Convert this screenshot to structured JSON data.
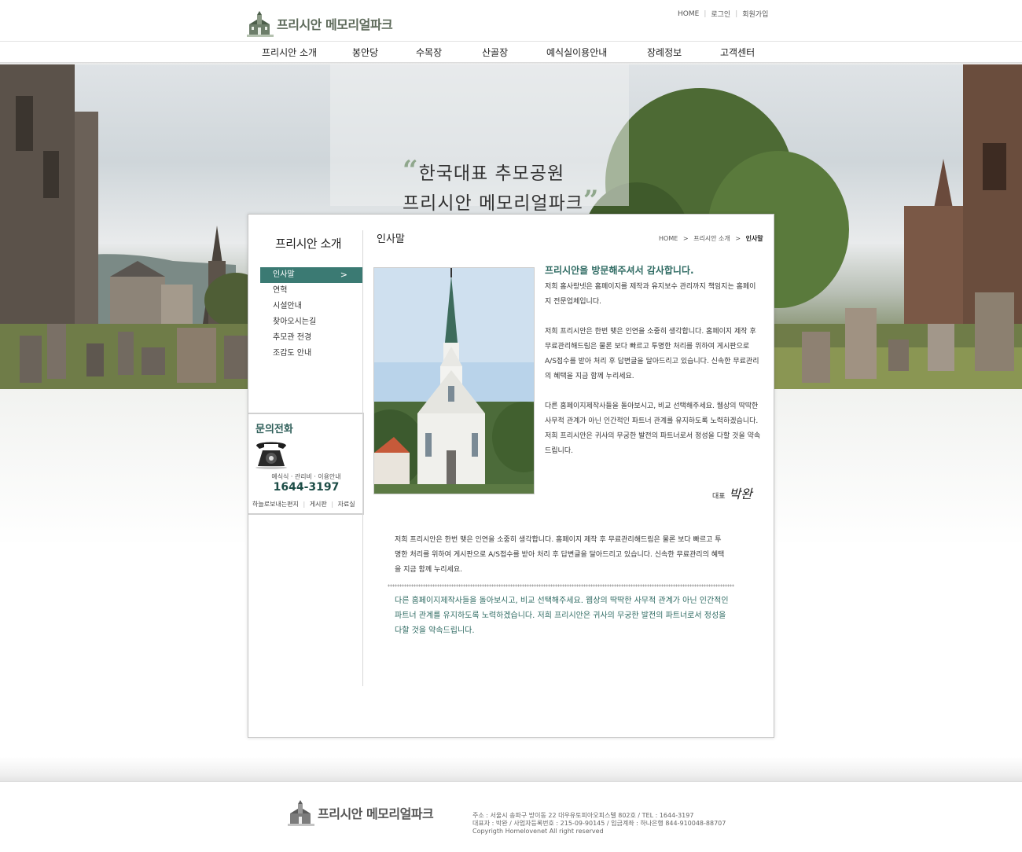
{
  "header": {
    "logo_text": "프리시안 메모리얼파크",
    "top_links": [
      "HOME",
      "로그인",
      "회원가입"
    ],
    "nav": [
      "프리시안 소개",
      "봉안당",
      "수목장",
      "산골장",
      "예식실이용안내",
      "장례정보",
      "고객센터"
    ]
  },
  "hero": {
    "quote_line1": "한국대표 추모공원",
    "quote_line2": "프리시안 메모리얼파크"
  },
  "sidebar": {
    "title": "프리시안 소개",
    "items": [
      {
        "label": "인사말",
        "active": true
      },
      {
        "label": "연혁"
      },
      {
        "label": "시설안내"
      },
      {
        "label": "찾아오시는길"
      },
      {
        "label": "추모관 전경"
      },
      {
        "label": "조감도 안내"
      }
    ],
    "active_arrow": ">",
    "contact": {
      "title": "문의전화",
      "sub": "예식식ㆍ관리비ㆍ이용안내",
      "number": "1644-3197",
      "links": [
        "하늘로보내는편지",
        "게시판",
        "자료실"
      ]
    }
  },
  "content": {
    "page_title": "인사말",
    "breadcrumb": [
      "HOME",
      "프리시안 소개",
      "인사말"
    ],
    "greeting_title": "프리시안을 방문해주셔서 감사합니다.",
    "paragraphs": [
      "저희 홈사랑넷은 홈페이지를 제작과 유지보수 관리까지 책임지는 홈페이지 전문업체입니다.",
      "저희 프리시안은 한번 맺은 인연을 소중히 생각합니다. 홈페이지 제작 후 무료관리해드림은 물론 보다 빠르고 투명한 처리를 위하여 게시판으로 A/S접수를 받아 처리 후 답변글을 달아드리고 있습니다. 신속한 무료관리의 혜택을 지금 함께 누리세요.",
      "다른 홈페이지제작사들을 돌아보시고, 비교 선택해주세요. 웹상의 딱딱한 사무적 관계가 아닌 인간적인 파트너 관계를 유지하도록 노력하겠습니다. 저희 프리시안은 귀사의 무궁한 발전의 파트너로서 정성을 다할 것을 약속드립니다."
    ],
    "sign_label": "대표",
    "sign_name": "박완",
    "lower_text": "저희 프리시안은 한번 맺은 인연을 소중히 생각합니다. 홈페이지 제작 후 무료관리해드림은 물론 보다 빠르고 투명한 처리를 위하여 게시판으로 A/S접수를 받아 처리 후 답변글을 달아드리고 있습니다. 신속한 무료관리의 혜택을 지금 함께 누리세요.",
    "lower_highlight": "다른 홈페이지제작사들을 돌아보시고, 비교 선택해주세요. 웹상의 딱딱한 사무적 관계가 아닌 인간적인 파트너 관계를 유지하도록 노력하겠습니다. 저희 프리시안은 귀사의 무궁한 발전의 파트너로서 정성을 다할 것을 약속드립니다."
  },
  "footer": {
    "logo_text": "프리시안 메모리얼파크",
    "address": "주소 : 서울시 송파구 방이동 22 대우유토피아오피스텔 802호 / TEL : 1644-3197",
    "business": "대표자 : 박완 / 사업자등록번호 : 215-09-90145 / 입금계좌 : 하나은행 844-910048-88707",
    "copyright": "Copyrigth Homelovenet All right reserved"
  },
  "colors": {
    "accent": "#3b7a73",
    "accent_text": "#2f6b63"
  }
}
